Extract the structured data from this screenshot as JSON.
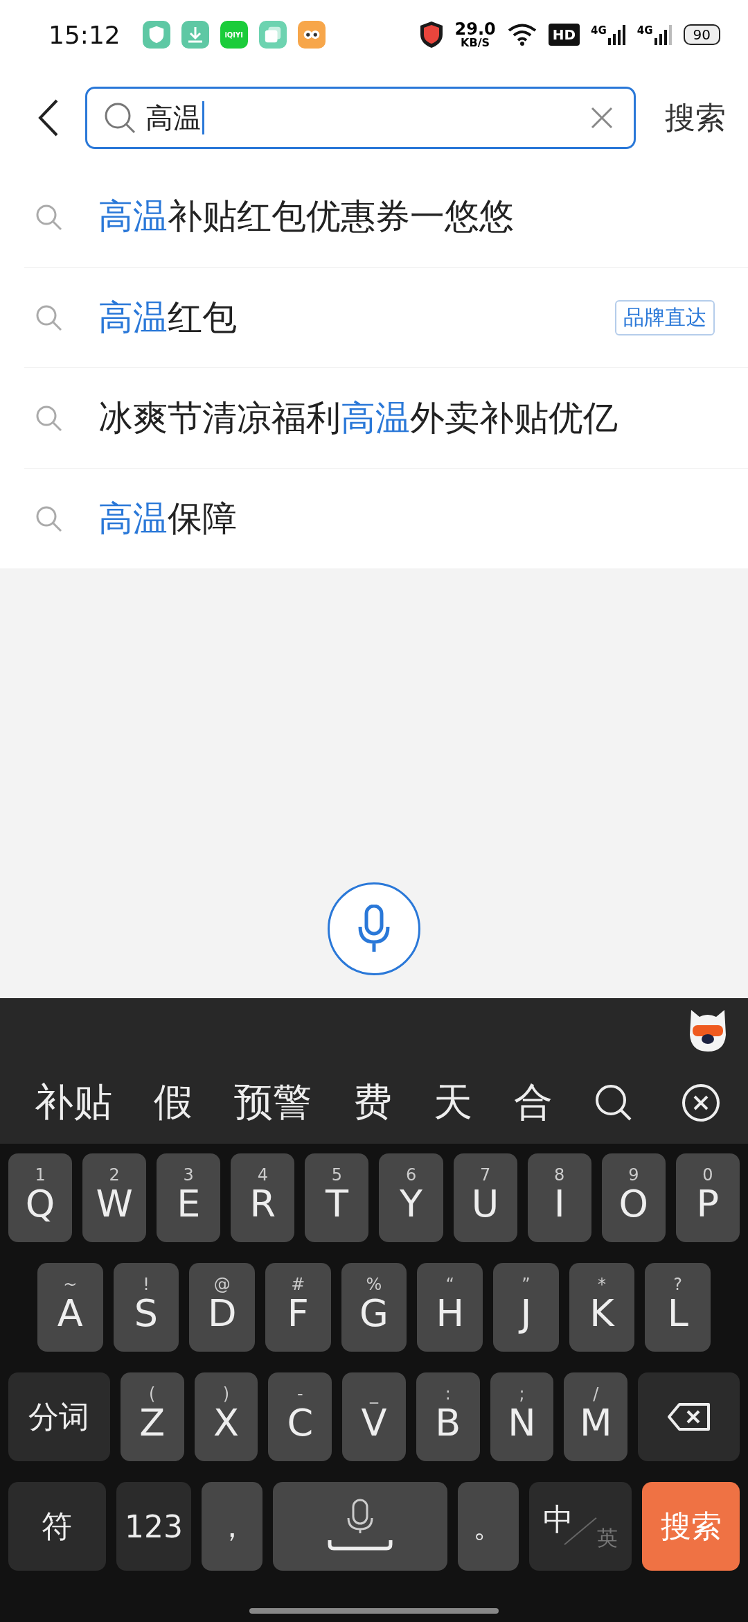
{
  "status_bar": {
    "time": "15:12",
    "apps": [
      {
        "kind": "shield"
      },
      {
        "kind": "download"
      },
      {
        "kind": "video",
        "label": "iQIYI"
      },
      {
        "kind": "cards"
      },
      {
        "kind": "game"
      }
    ],
    "speed": "29.0",
    "speed_unit": "KB/S",
    "hd": "HD",
    "networks": [
      "4G",
      "4G"
    ],
    "battery": "90"
  },
  "search": {
    "value": "高温",
    "submit": "搜索"
  },
  "suggestions": [
    {
      "parts": [
        {
          "text": "高温",
          "highlight": true
        },
        {
          "text": "补贴红包优惠券一悠悠",
          "highlight": false
        }
      ]
    },
    {
      "parts": [
        {
          "text": "高温",
          "highlight": true
        },
        {
          "text": "红包",
          "highlight": false
        }
      ],
      "tag": "品牌直达"
    },
    {
      "parts": [
        {
          "text": "冰爽节清凉福利",
          "highlight": false
        },
        {
          "text": "高温",
          "highlight": true
        },
        {
          "text": "外卖补贴优亿",
          "highlight": false
        }
      ]
    },
    {
      "parts": [
        {
          "text": "高温",
          "highlight": true
        },
        {
          "text": "保障",
          "highlight": false
        }
      ]
    }
  ],
  "keyboard": {
    "candidates": [
      "补贴",
      "假",
      "预警",
      "费",
      "天",
      "合"
    ],
    "rows": [
      {
        "keys": [
          {
            "kind": "letter",
            "label": "Q",
            "hint": "1"
          },
          {
            "kind": "letter",
            "label": "W",
            "hint": "2"
          },
          {
            "kind": "letter",
            "label": "E",
            "hint": "3"
          },
          {
            "kind": "letter",
            "label": "R",
            "hint": "4"
          },
          {
            "kind": "letter",
            "label": "T",
            "hint": "5"
          },
          {
            "kind": "letter",
            "label": "Y",
            "hint": "6"
          },
          {
            "kind": "letter",
            "label": "U",
            "hint": "7"
          },
          {
            "kind": "letter",
            "label": "I",
            "hint": "8"
          },
          {
            "kind": "letter",
            "label": "O",
            "hint": "9"
          },
          {
            "kind": "letter",
            "label": "P",
            "hint": "0"
          }
        ]
      },
      {
        "keys": [
          {
            "kind": "letter",
            "label": "A",
            "hint": "~"
          },
          {
            "kind": "letter",
            "label": "S",
            "hint": "!"
          },
          {
            "kind": "letter",
            "label": "D",
            "hint": "@"
          },
          {
            "kind": "letter",
            "label": "F",
            "hint": "#"
          },
          {
            "kind": "letter",
            "label": "G",
            "hint": "%"
          },
          {
            "kind": "letter",
            "label": "H",
            "hint": "“"
          },
          {
            "kind": "letter",
            "label": "J",
            "hint": "”"
          },
          {
            "kind": "letter",
            "label": "K",
            "hint": "*"
          },
          {
            "kind": "letter",
            "label": "L",
            "hint": "?"
          }
        ]
      },
      {
        "keys": [
          {
            "kind": "function",
            "label": "分词"
          },
          {
            "kind": "letter",
            "label": "Z",
            "hint": "("
          },
          {
            "kind": "letter",
            "label": "X",
            "hint": ")"
          },
          {
            "kind": "letter",
            "label": "C",
            "hint": "-"
          },
          {
            "kind": "letter",
            "label": "V",
            "hint": "_"
          },
          {
            "kind": "letter",
            "label": "B",
            "hint": ":"
          },
          {
            "kind": "letter",
            "label": "N",
            "hint": ";"
          },
          {
            "kind": "letter",
            "label": "M",
            "hint": "/"
          },
          {
            "kind": "backspace"
          }
        ]
      },
      {
        "keys": [
          {
            "kind": "function",
            "label": "符"
          },
          {
            "kind": "function",
            "label": "123"
          },
          {
            "kind": "punct",
            "label": "，"
          },
          {
            "kind": "space"
          },
          {
            "kind": "punct",
            "label": "。"
          },
          {
            "kind": "lang",
            "label": "中",
            "sub": "英"
          },
          {
            "kind": "action",
            "label": "搜索"
          }
        ]
      }
    ]
  }
}
